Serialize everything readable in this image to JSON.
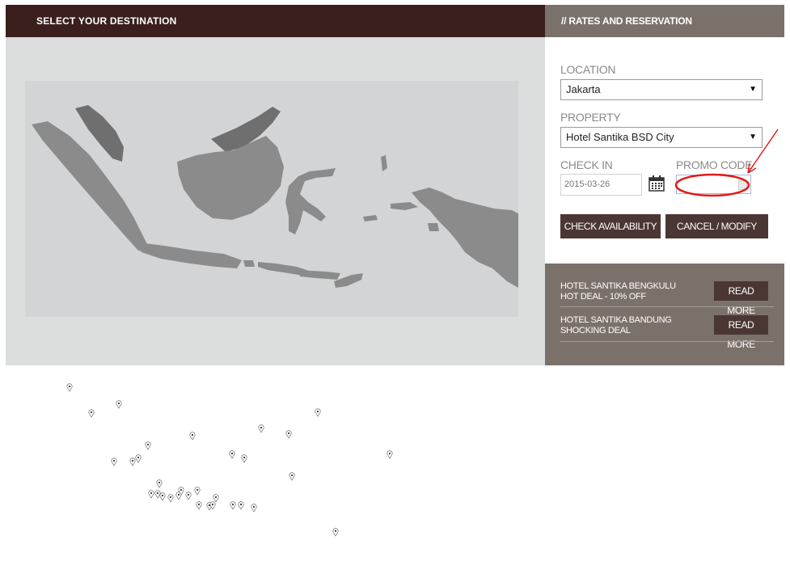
{
  "left_panel": {
    "header": "SELECT YOUR DESTINATION"
  },
  "right_panel": {
    "header": "// RATES AND RESERVATION",
    "location_label": "LOCATION",
    "location_value": "Jakarta",
    "property_label": "PROPERTY",
    "property_value": "Hotel Santika BSD City",
    "checkin_label": "CHECK IN",
    "checkin_value": "2015-03-26",
    "promo_label": "PROMO CODE",
    "promo_value": "",
    "check_availability": "CHECK AVAILABILITY",
    "cancel_modify": "CANCEL / MODIFY",
    "deals": [
      {
        "title": "HOTEL SANTIKA BENGKULU",
        "subtitle": "HOT DEAL - 10% OFF",
        "button": "READ MORE"
      },
      {
        "title": "HOTEL SANTIKA BANDUNG",
        "subtitle": "SHOCKING DEAL",
        "button": "READ MORE"
      }
    ]
  },
  "annotation": {
    "circle_color": "#e01b1b"
  }
}
